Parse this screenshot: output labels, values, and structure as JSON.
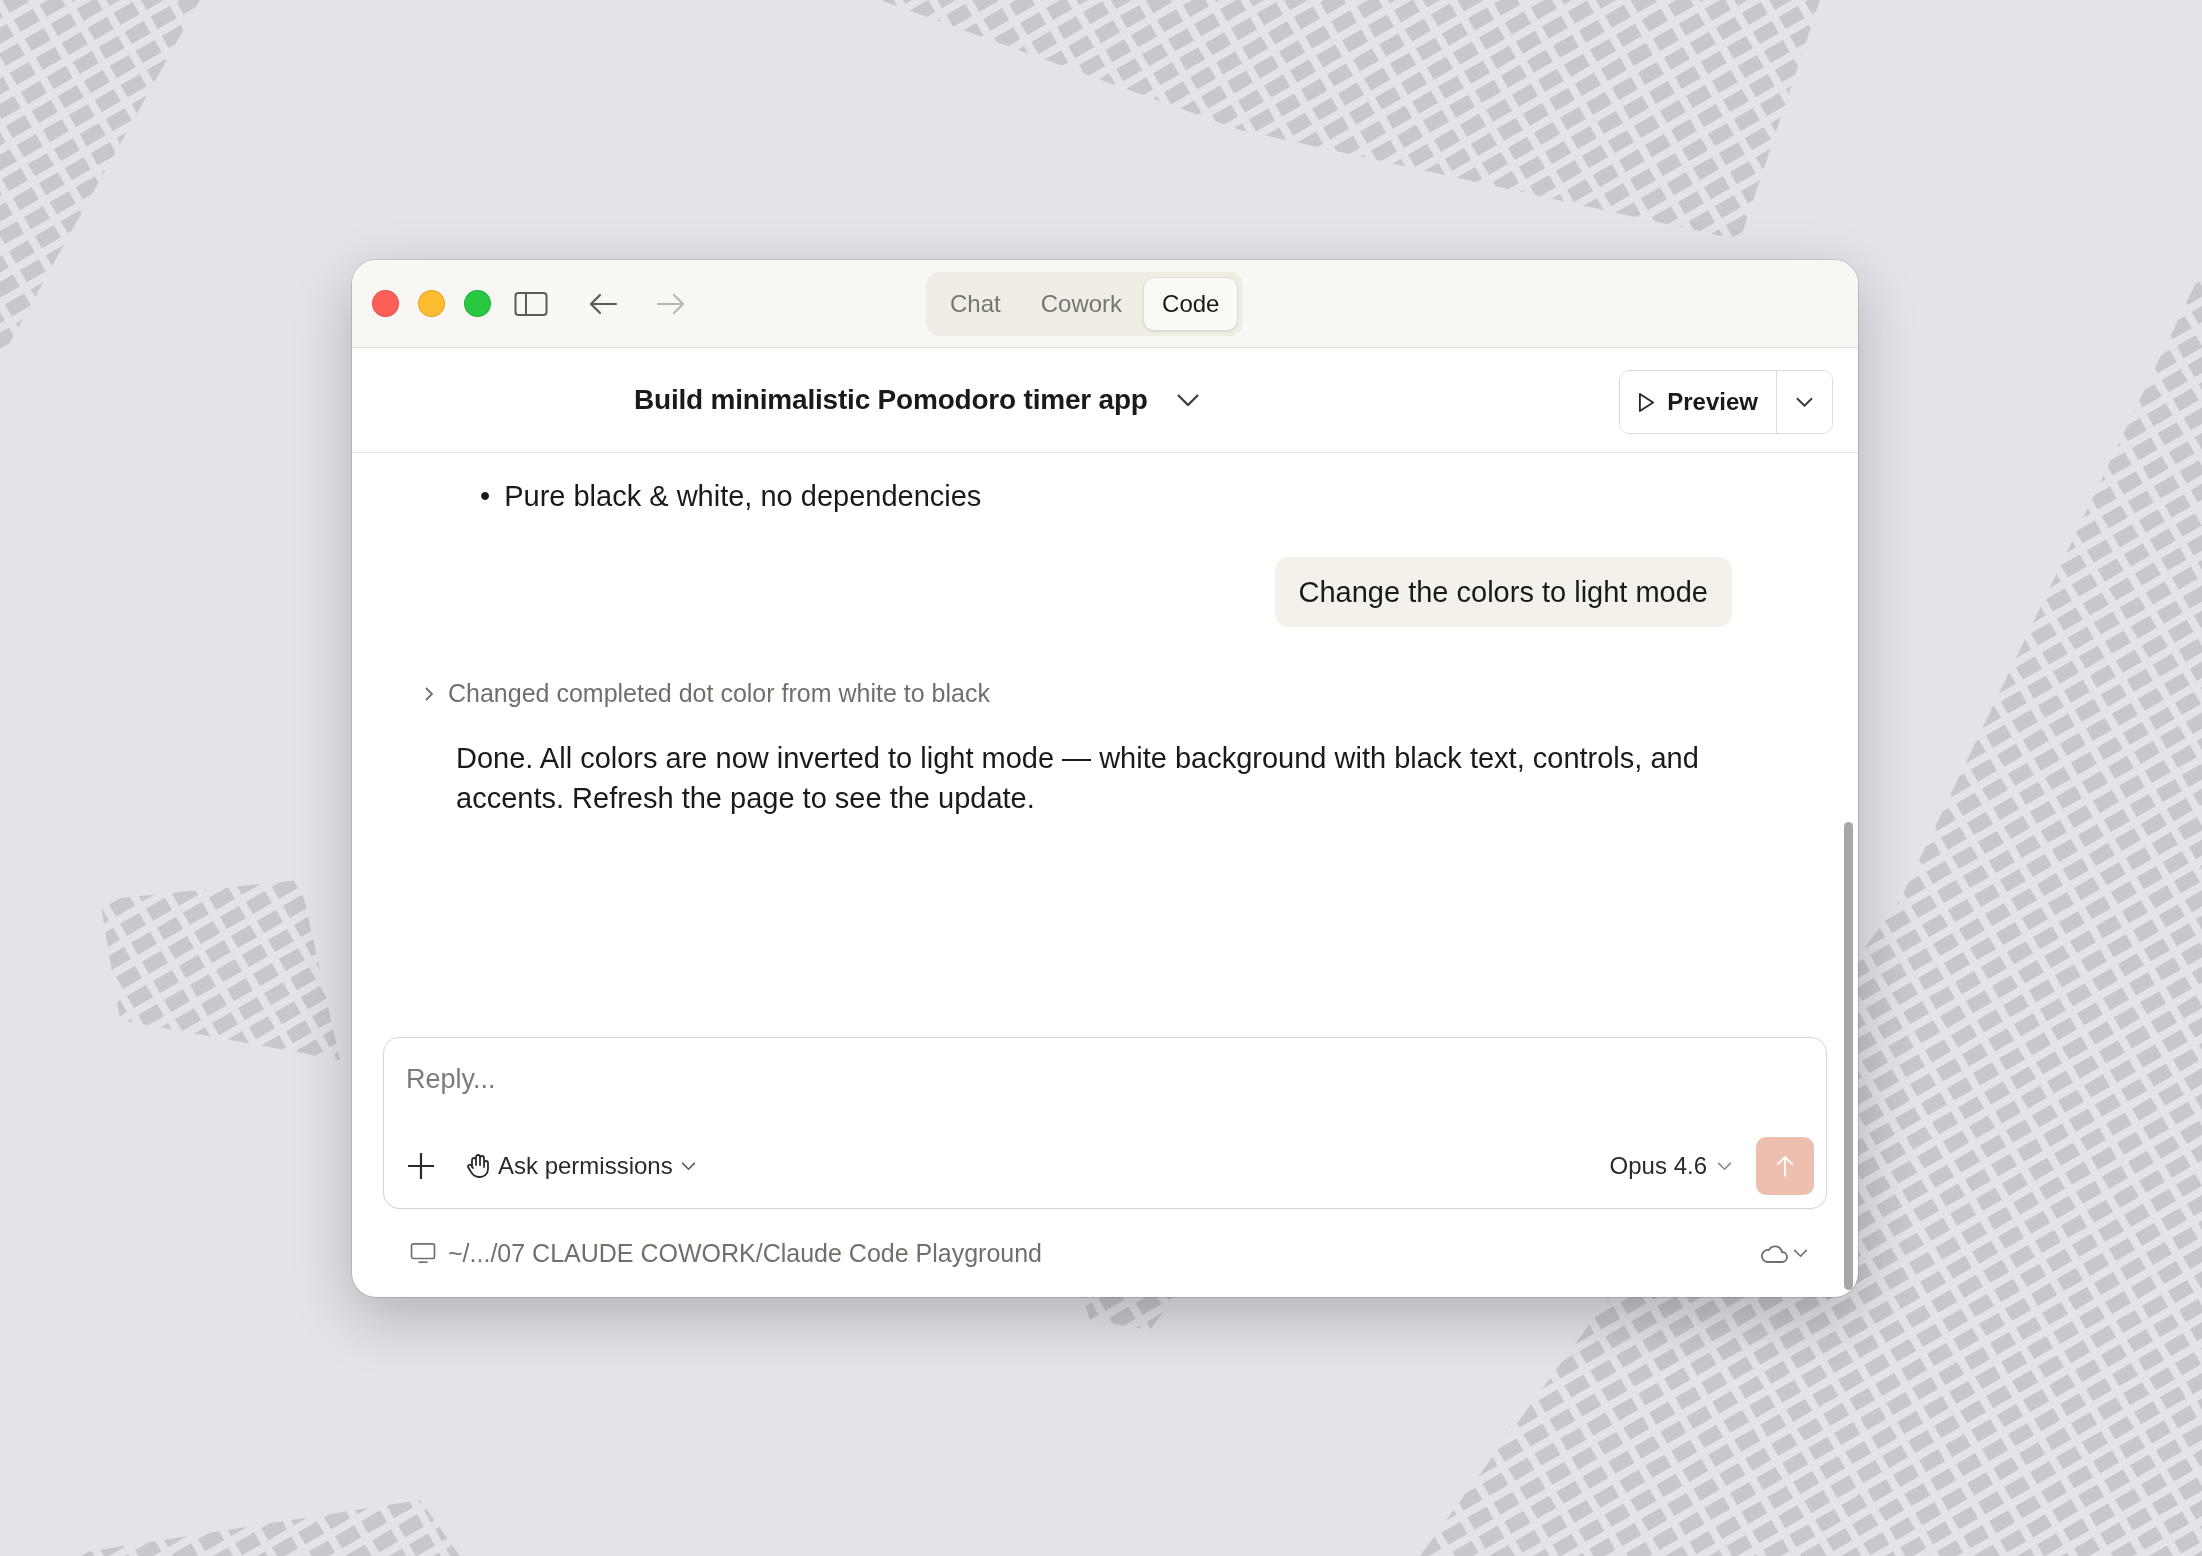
{
  "window": {
    "traffic_lights": [
      {
        "color": "#ff5f57"
      },
      {
        "color": "#febc2e"
      },
      {
        "color": "#28c840"
      }
    ],
    "back_disabled": false,
    "forward_disabled": true
  },
  "tabs": [
    {
      "label": "Chat",
      "selected": false
    },
    {
      "label": "Cowork",
      "selected": false
    },
    {
      "label": "Code",
      "selected": true
    }
  ],
  "header": {
    "title": "Build minimalistic Pomodoro timer app",
    "preview_button": "Preview"
  },
  "conversation": {
    "bullets": [
      {
        "marker": "•",
        "text": "Pure black & white, no dependencies"
      }
    ],
    "user_message": "Change the colors to light mode",
    "activity": {
      "label": "Changed completed dot color from white to black",
      "expanded": false
    },
    "reply": "Done. All colors are now inverted to light mode — white background with black text, controls, and accents. Refresh the page to see the update."
  },
  "composer": {
    "placeholder": "Reply...",
    "permission": "Ask permissions",
    "model": "Opus 4.6",
    "send_disabled": true
  },
  "footer": {
    "path": "~/.../07 CLAUDE COWORK/Claude Code Playground"
  }
}
